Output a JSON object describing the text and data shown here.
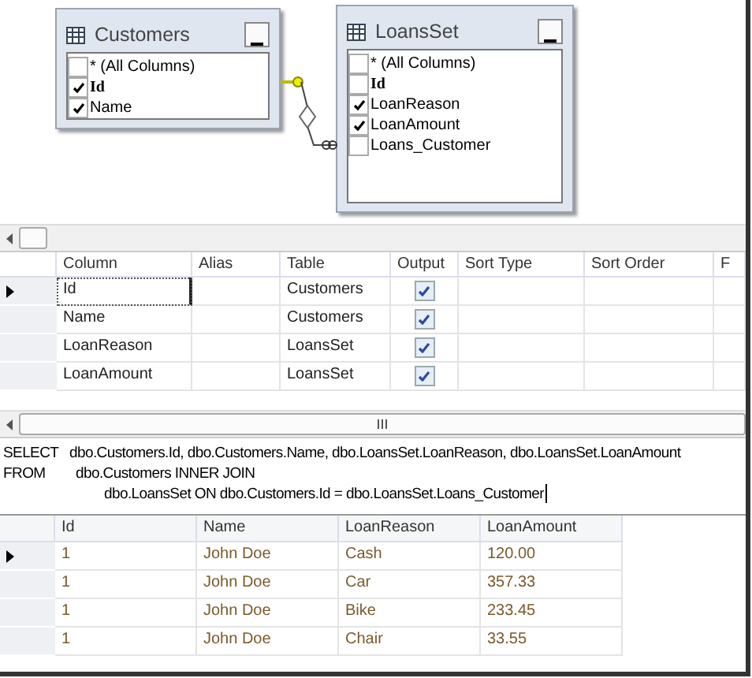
{
  "diagram": {
    "tables": [
      {
        "title": "Customers",
        "columns": [
          {
            "name": "* (All Columns)",
            "checked": false,
            "key": false
          },
          {
            "name": "Id",
            "checked": true,
            "key": true
          },
          {
            "name": "Name",
            "checked": true,
            "key": false
          }
        ]
      },
      {
        "title": "LoansSet",
        "columns": [
          {
            "name": "* (All Columns)",
            "checked": false,
            "key": false
          },
          {
            "name": "Id",
            "checked": false,
            "key": true
          },
          {
            "name": "LoanReason",
            "checked": true,
            "key": false
          },
          {
            "name": "LoanAmount",
            "checked": true,
            "key": false
          },
          {
            "name": "Loans_Customer",
            "checked": false,
            "key": false
          }
        ]
      }
    ]
  },
  "criteria": {
    "columns": [
      "Column",
      "Alias",
      "Table",
      "Output",
      "Sort Type",
      "Sort Order",
      "F"
    ],
    "rows": [
      {
        "column": "Id",
        "table": "Customers",
        "output": true,
        "selected": true
      },
      {
        "column": "Name",
        "table": "Customers",
        "output": true,
        "selected": false
      },
      {
        "column": "LoanReason",
        "table": "LoansSet",
        "output": true,
        "selected": false
      },
      {
        "column": "LoanAmount",
        "table": "LoansSet",
        "output": true,
        "selected": false
      }
    ]
  },
  "sql": {
    "lines": [
      {
        "keyword": "SELECT",
        "text": "dbo.Customers.Id, dbo.Customers.Name, dbo.LoansSet.LoanReason, dbo.LoansSet.LoanAmount"
      },
      {
        "keyword": "FROM",
        "text": "dbo.Customers INNER JOIN"
      },
      {
        "text": "dbo.LoansSet ON dbo.Customers.Id = dbo.LoansSet.Loans_Customer"
      }
    ]
  },
  "results": {
    "columns": [
      "Id",
      "Name",
      "LoanReason",
      "LoanAmount"
    ],
    "rows": [
      {
        "cells": [
          "1",
          "John Doe",
          "Cash",
          "120.00"
        ],
        "selected": true
      },
      {
        "cells": [
          "1",
          "John Doe",
          "Car",
          "357.33"
        ],
        "selected": false
      },
      {
        "cells": [
          "1",
          "John Doe",
          "Bike",
          "233.45"
        ],
        "selected": false
      },
      {
        "cells": [
          "1",
          "John Doe",
          "Chair",
          "33.55"
        ],
        "selected": false
      }
    ]
  }
}
